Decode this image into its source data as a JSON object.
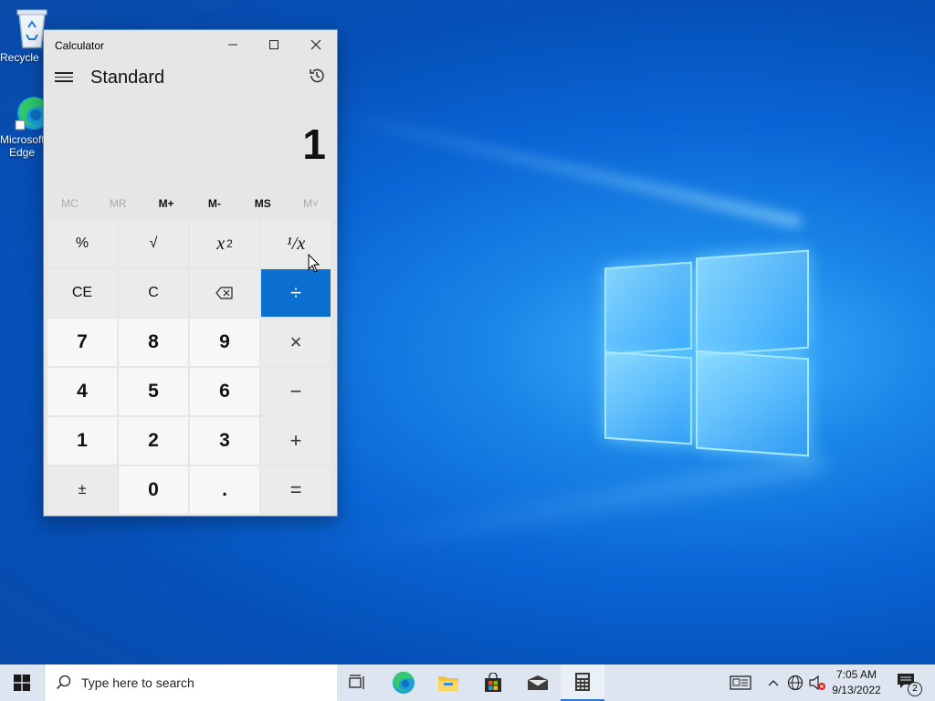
{
  "desktop": {
    "icons": [
      {
        "label": "Recycle Bin",
        "icon": "recycle-bin-icon"
      },
      {
        "label": "Microsoft Edge",
        "icon": "edge-icon"
      }
    ]
  },
  "calculator": {
    "window_title": "Calculator",
    "mode": "Standard",
    "display_value": "1",
    "memory_buttons": [
      "MC",
      "MR",
      "M+",
      "M-",
      "MS",
      "M˅"
    ],
    "keys": {
      "percent": "%",
      "sqrt": "√",
      "square_base": "x",
      "square_exp": "2",
      "reciprocal": "¹/x",
      "ce": "CE",
      "c": "C",
      "divide": "÷",
      "multiply": "×",
      "minus": "−",
      "plus": "+",
      "equals": "=",
      "negate": "±",
      "decimal": ".",
      "seven": "7",
      "eight": "8",
      "nine": "9",
      "four": "4",
      "five": "5",
      "six": "6",
      "one": "1",
      "two": "2",
      "three": "3",
      "zero": "0"
    },
    "active_key": "divide",
    "colors": {
      "accent": "#0a6fcf"
    }
  },
  "taskbar": {
    "search_placeholder": "Type here to search",
    "apps": [
      "task-view-icon",
      "edge-icon",
      "file-explorer-icon",
      "store-icon",
      "mail-icon",
      "calculator-icon"
    ],
    "clock_time": "7:05 AM",
    "clock_date": "9/13/2022",
    "notification_count": "2"
  }
}
